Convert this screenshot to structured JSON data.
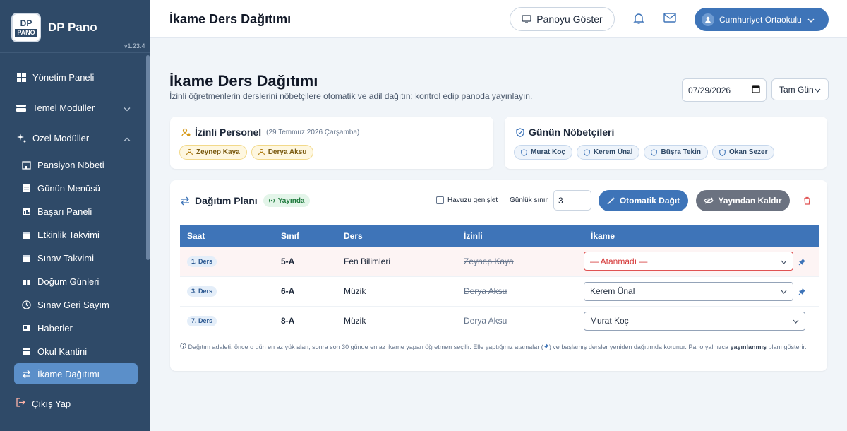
{
  "app": {
    "name": "DP Pano",
    "version": "v1.23.4",
    "logo_top": "DP",
    "logo_bottom": "PANO"
  },
  "sidebar": {
    "items": [
      {
        "label": "Yönetim Paneli",
        "icon": "dashboard-icon"
      },
      {
        "label": "Temel Modüller",
        "icon": "layers-icon"
      },
      {
        "label": "Özel Modüller",
        "icon": "sparkle-icon"
      },
      {
        "label": "Pansiyon Nöbeti",
        "icon": "building-icon"
      },
      {
        "label": "Günün Menüsü",
        "icon": "menu-icon"
      },
      {
        "label": "Başarı Paneli",
        "icon": "trophy-icon"
      },
      {
        "label": "Etkinlik Takvimi",
        "icon": "calendar-icon"
      },
      {
        "label": "Sınav Takvimi",
        "icon": "calendar-icon"
      },
      {
        "label": "Doğum Günleri",
        "icon": "gift-icon"
      },
      {
        "label": "Sınav Geri Sayım",
        "icon": "clock-icon"
      },
      {
        "label": "Haberler",
        "icon": "news-icon"
      },
      {
        "label": "Okul Kantini",
        "icon": "store-icon"
      },
      {
        "label": "İkame Dağıtımı",
        "icon": "swap-icon"
      }
    ],
    "logout": "Çıkış Yap"
  },
  "topbar": {
    "title": "İkame Ders Dağıtımı",
    "show_board": "Panoyu Göster",
    "school": "Cumhuriyet Ortaokulu"
  },
  "page": {
    "title": "İkame Ders Dağıtımı",
    "subtitle": "İzinli öğretmenlerin derslerini nöbetçilere otomatik ve adil dağıtın; kontrol edip panoda yayınlayın.",
    "date": "07/29/2026",
    "day_mode": "Tam Gün"
  },
  "izinli": {
    "title": "İzinli Personel",
    "date": "(29 Temmuz 2026 Çarşamba)",
    "people": [
      "Zeynep Kaya",
      "Derya Aksu"
    ]
  },
  "nobet": {
    "title": "Günün Nöbetçileri",
    "people": [
      "Murat Koç",
      "Kerem Ünal",
      "Büşra Tekin",
      "Okan Sezer"
    ]
  },
  "plan": {
    "title": "Dağıtım Planı",
    "live": "Yayında",
    "pool": "Havuzu genişlet",
    "limit_label": "Günlük sınır",
    "limit_value": "3",
    "auto_btn": "Otomatik Dağıt",
    "unpublish_btn": "Yayından Kaldır",
    "columns": [
      "Saat",
      "Sınıf",
      "Ders",
      "İzinli",
      "İkame"
    ],
    "rows": [
      {
        "saat": "1. Ders",
        "sinif": "5-A",
        "ders": "Fen Bilimleri",
        "izinli": "Zeynep Kaya",
        "ikame": "— Atanmadı —"
      },
      {
        "saat": "3. Ders",
        "sinif": "6-A",
        "ders": "Müzik",
        "izinli": "Derya Aksu",
        "ikame": "Kerem Ünal"
      },
      {
        "saat": "7. Ders",
        "sinif": "8-A",
        "ders": "Müzik",
        "izinli": "Derya Aksu",
        "ikame": "Murat Koç"
      }
    ],
    "footnote_a": "Dağıtım adaleti: önce o gün en az yük alan, sonra son 30 günde en az ikame yapan öğretmen seçilir. Elle yaptığınız atamalar (",
    "footnote_b": ") ve başlamış dersler yeniden dağıtımda korunur. Pano yalnızca ",
    "footnote_bold": "yayınlanmış",
    "footnote_c": " planı gösterir."
  },
  "colors": {
    "sidebar": "#2f4a68",
    "accent": "#3e74b8",
    "active": "#5b8fc9",
    "danger": "#e05252"
  }
}
